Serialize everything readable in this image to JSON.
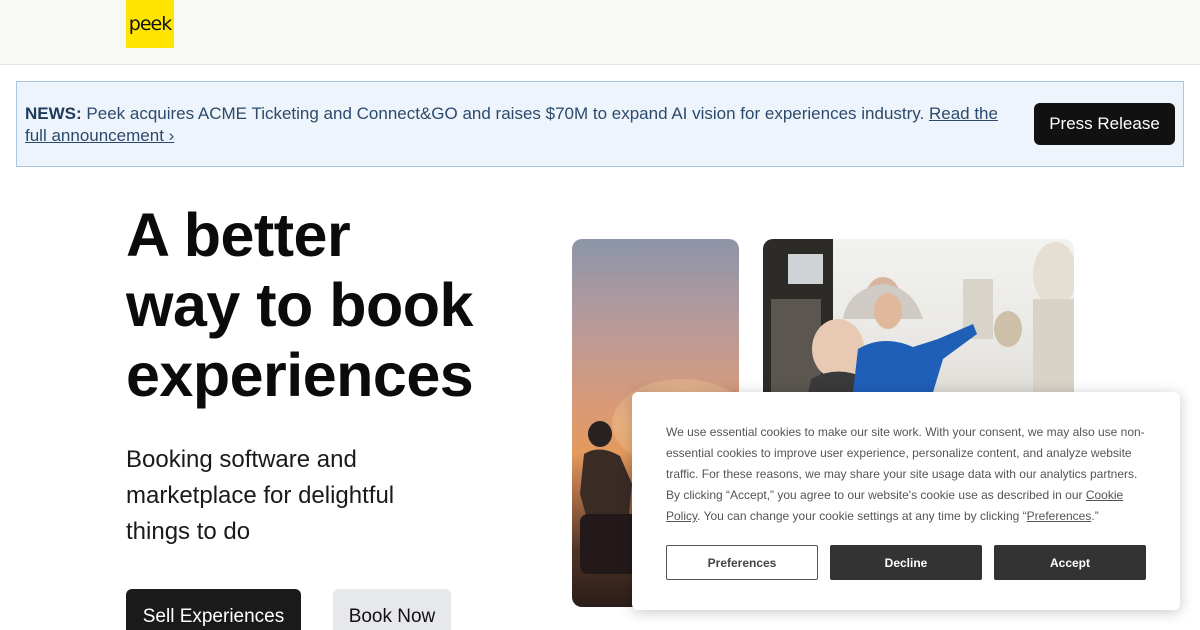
{
  "logo": {
    "text": "peek",
    "color": "#ffe500"
  },
  "news": {
    "label": "NEWS:",
    "message": " Peek acquires ACME Ticketing and Connect&GO and raises $70M to expand AI vision for experiences industry. ",
    "link_text": "Read the full announcement ›",
    "button": "Press Release"
  },
  "hero": {
    "title_lines": [
      "A better",
      "way to book",
      "experiences"
    ],
    "subtitle": "Booking software and marketplace for delightful things to do",
    "sell_button": "Sell Experiences",
    "book_button": "Book Now"
  },
  "cookie": {
    "text_before_link1": "We use essential cookies to make our site work. With your consent, we may also use non-essential cookies to improve user experience, personalize content, and analyze website traffic. For these reasons, we may share your site usage data with our analytics partners. By clicking “Accept,” you agree to our website's cookie use as described in our ",
    "link1": "Cookie Policy",
    "text_between": ". You can change your cookie settings at any time by clicking “",
    "link2": "Preferences",
    "text_after": ".”",
    "preferences_button": "Preferences",
    "decline_button": "Decline",
    "accept_button": "Accept"
  }
}
